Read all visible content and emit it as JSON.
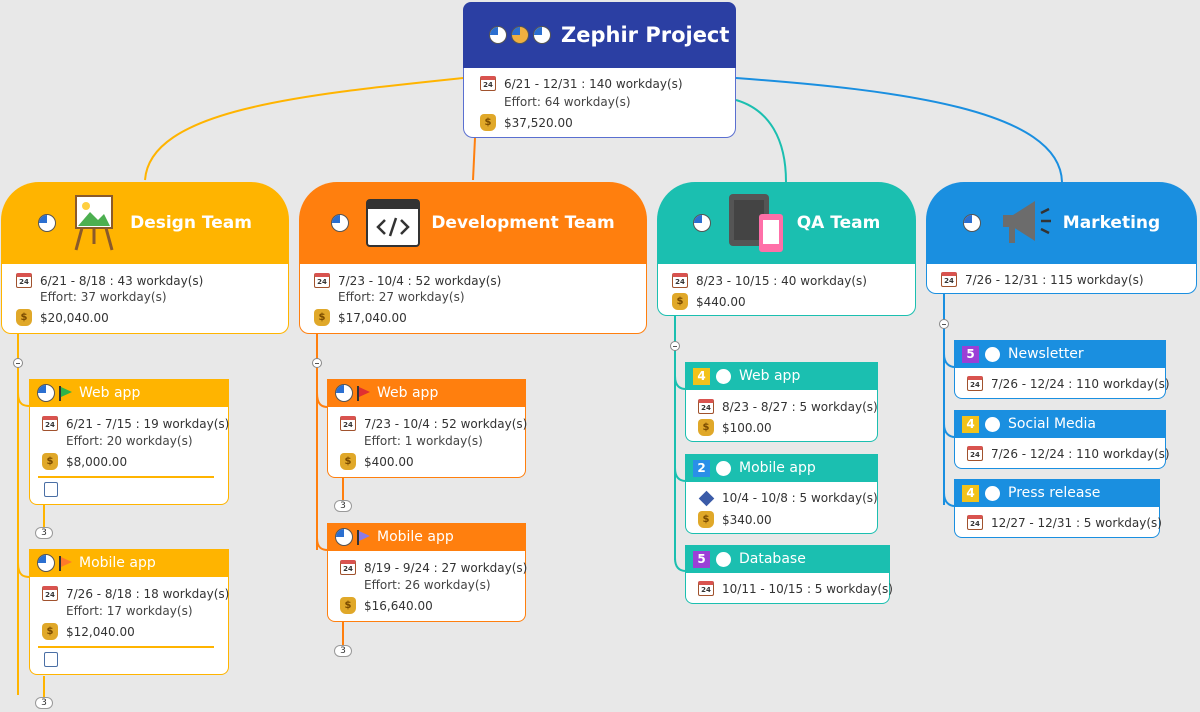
{
  "root": {
    "title": "Zephir Project",
    "dates": "6/21 - 12/31 : 140 workday(s)",
    "effort": "Effort: 64 workday(s)",
    "cost": "$37,520.00"
  },
  "teams": [
    {
      "title": "Design Team",
      "dates": "6/21 - 8/18 : 43 workday(s)",
      "effort": "Effort: 37 workday(s)",
      "cost": "$20,040.00",
      "color": "#ffb400",
      "icon": "easel-picture-icon"
    },
    {
      "title": "Development Team",
      "dates": "7/23 - 10/4 : 52 workday(s)",
      "effort": "Effort: 27 workday(s)",
      "cost": "$17,040.00",
      "color": "#ff7f0e",
      "icon": "code-window-icon"
    },
    {
      "title": "QA Team",
      "dates": "8/23 - 10/15 : 40 workday(s)",
      "cost": "$440.00",
      "color": "#1bbfb0",
      "icon": "tablet-phone-icon"
    },
    {
      "title": "Marketing",
      "dates": "7/26 - 12/31 : 115 workday(s)",
      "color": "#1a8fe0",
      "icon": "megaphone-icon"
    }
  ],
  "design_tasks": [
    {
      "title": "Web app",
      "dates": "6/21 - 7/15 : 19 workday(s)",
      "effort": "Effort: 20 workday(s)",
      "cost": "$8,000.00",
      "flag_color": "#2fb34a",
      "badge": "3"
    },
    {
      "title": "Mobile app",
      "dates": "7/26 - 8/18 : 18 workday(s)",
      "effort": "Effort: 17 workday(s)",
      "cost": "$12,040.00",
      "flag_color": "#ff7a2a",
      "badge": "3"
    }
  ],
  "dev_tasks": [
    {
      "title": "Web app",
      "dates": "7/23 - 10/4 : 52 workday(s)",
      "effort": "Effort: 1 workday(s)",
      "cost": "$400.00",
      "flag_color": "#e03030",
      "badge": "3"
    },
    {
      "title": "Mobile app",
      "dates": "8/19 - 9/24 : 27 workday(s)",
      "effort": "Effort: 26 workday(s)",
      "cost": "$16,640.00",
      "flag_color": "#8a7be8",
      "badge": "3"
    }
  ],
  "qa_tasks": [
    {
      "priority": "4",
      "title": "Web app",
      "dates": "8/23 - 8/27 : 5 workday(s)",
      "cost": "$100.00",
      "priority_color": "#f2c21b"
    },
    {
      "priority": "2",
      "title": "Mobile app",
      "dates": "10/4 - 10/8 : 5 workday(s)",
      "cost": "$340.00",
      "priority_color": "#2a8fe8"
    },
    {
      "priority": "5",
      "title": "Database",
      "dates": "10/11 - 10/15 : 5 workday(s)",
      "priority_color": "#9b3fd6"
    }
  ],
  "marketing_tasks": [
    {
      "priority": "5",
      "title": "Newsletter",
      "dates": "7/26 - 12/24 : 110 workday(s)",
      "priority_color": "#9b3fd6"
    },
    {
      "priority": "4",
      "title": "Social Media",
      "dates": "7/26 - 12/24 : 110 workday(s)",
      "priority_color": "#f2c21b"
    },
    {
      "priority": "4",
      "title": "Press release",
      "dates": "12/27 - 12/31 : 5 workday(s)",
      "priority_color": "#f2c21b"
    }
  ],
  "calendar_day": "24",
  "currency_symbol": "$"
}
